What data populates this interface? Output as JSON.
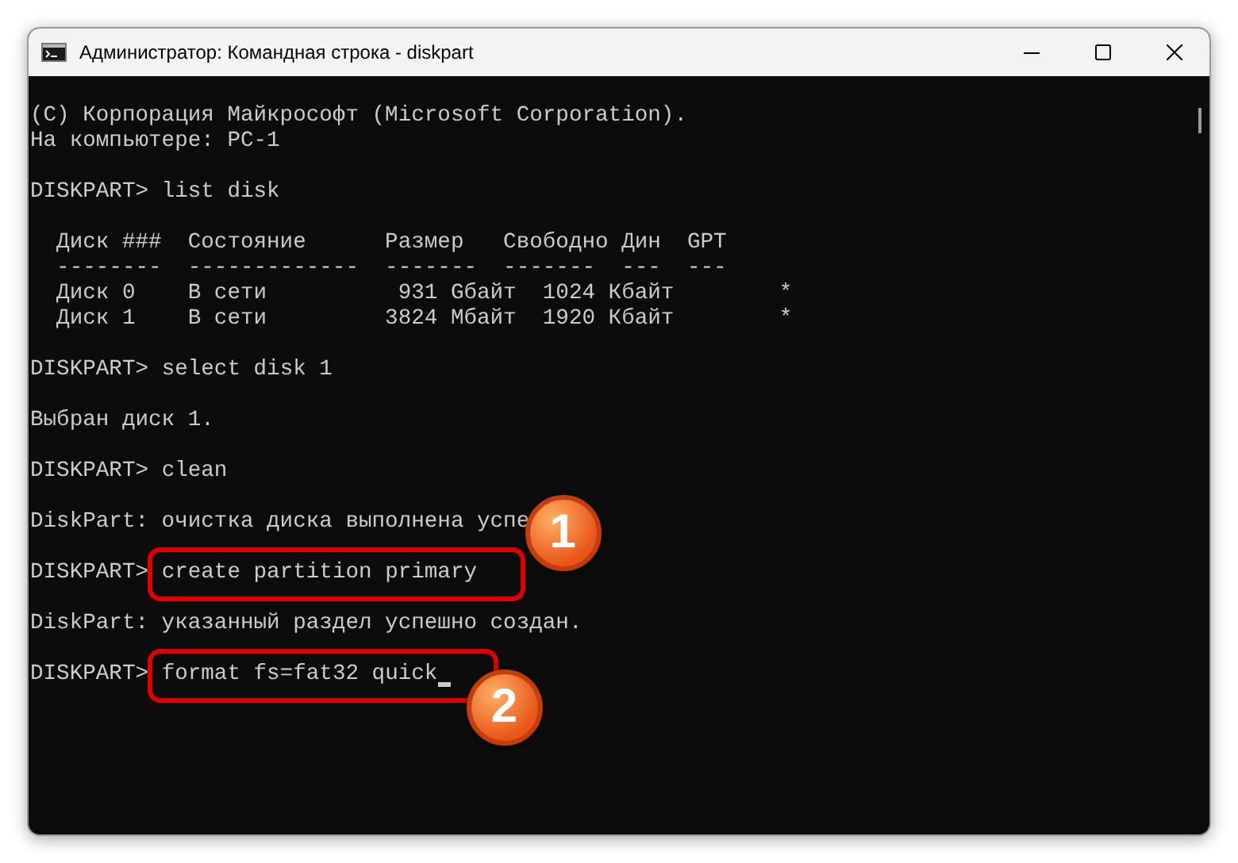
{
  "window": {
    "title": "Администратор: Командная строка - diskpart"
  },
  "console": {
    "lines": [
      {
        "kind": "output",
        "text": "(C) Корпорация Майкрософт (Microsoft Corporation)."
      },
      {
        "kind": "output",
        "text": "На компьютере: PC-1"
      },
      {
        "kind": "blank"
      },
      {
        "kind": "command",
        "prompt": "DISKPART>",
        "text": "list disk",
        "highlighted": false,
        "cursor": false
      },
      {
        "kind": "blank"
      },
      {
        "kind": "output",
        "text": "  Диск ###  Состояние      Размер   Свободно Дин  GPT"
      },
      {
        "kind": "output",
        "text": "  --------  -------------  -------  -------  ---  ---"
      },
      {
        "kind": "output",
        "text": "  Диск 0    В сети          931 Gбайт  1024 Кбайт        *"
      },
      {
        "kind": "output",
        "text": "  Диск 1    В сети         3824 Мбайт  1920 Кбайт        *"
      },
      {
        "kind": "blank"
      },
      {
        "kind": "command",
        "prompt": "DISKPART>",
        "text": "select disk 1",
        "highlighted": false,
        "cursor": false
      },
      {
        "kind": "blank"
      },
      {
        "kind": "output",
        "text": "Выбран диск 1."
      },
      {
        "kind": "blank"
      },
      {
        "kind": "command",
        "prompt": "DISKPART>",
        "text": "clean",
        "highlighted": false,
        "cursor": false
      },
      {
        "kind": "blank"
      },
      {
        "kind": "output",
        "text": "DiskPart: очистка диска выполнена успе"
      },
      {
        "kind": "blank"
      },
      {
        "kind": "command",
        "prompt": "DISKPART>",
        "text": "create partition primary",
        "highlighted": true,
        "cursor": false,
        "callout": {
          "number": "1",
          "kind": "above"
        }
      },
      {
        "kind": "blank"
      },
      {
        "kind": "output",
        "text": "DiskPart: указанный раздел успешно создан."
      },
      {
        "kind": "blank"
      },
      {
        "kind": "command",
        "prompt": "DISKPART>",
        "text": "format fs=fat32 quick",
        "highlighted": true,
        "cursor": true,
        "callout": {
          "number": "2",
          "kind": "below"
        }
      }
    ]
  }
}
